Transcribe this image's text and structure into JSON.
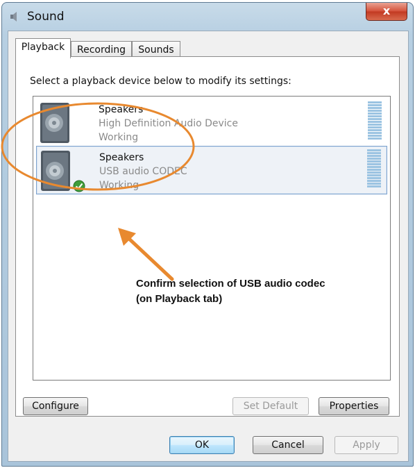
{
  "window": {
    "title": "Sound",
    "close_label": "x"
  },
  "tabs": [
    {
      "label": "Playback",
      "active": true
    },
    {
      "label": "Recording",
      "active": false
    },
    {
      "label": "Sounds",
      "active": false
    }
  ],
  "instruction": "Select a playback device below to modify its settings:",
  "devices": [
    {
      "name": "Speakers",
      "description": "High Definition Audio Device",
      "status": "Working",
      "selected": false,
      "default": false,
      "icon": "speaker-icon"
    },
    {
      "name": "Speakers",
      "description": "USB audio CODEC",
      "status": "Working",
      "selected": true,
      "default": true,
      "icon": "speaker-icon"
    }
  ],
  "annotation": {
    "text": "Confirm selection of USB audio codec\n(on Playback tab)",
    "color": "#e8892f"
  },
  "buttons": {
    "configure": "Configure",
    "set_default": "Set Default",
    "properties": "Properties",
    "ok": "OK",
    "cancel": "Cancel",
    "apply": "Apply"
  }
}
